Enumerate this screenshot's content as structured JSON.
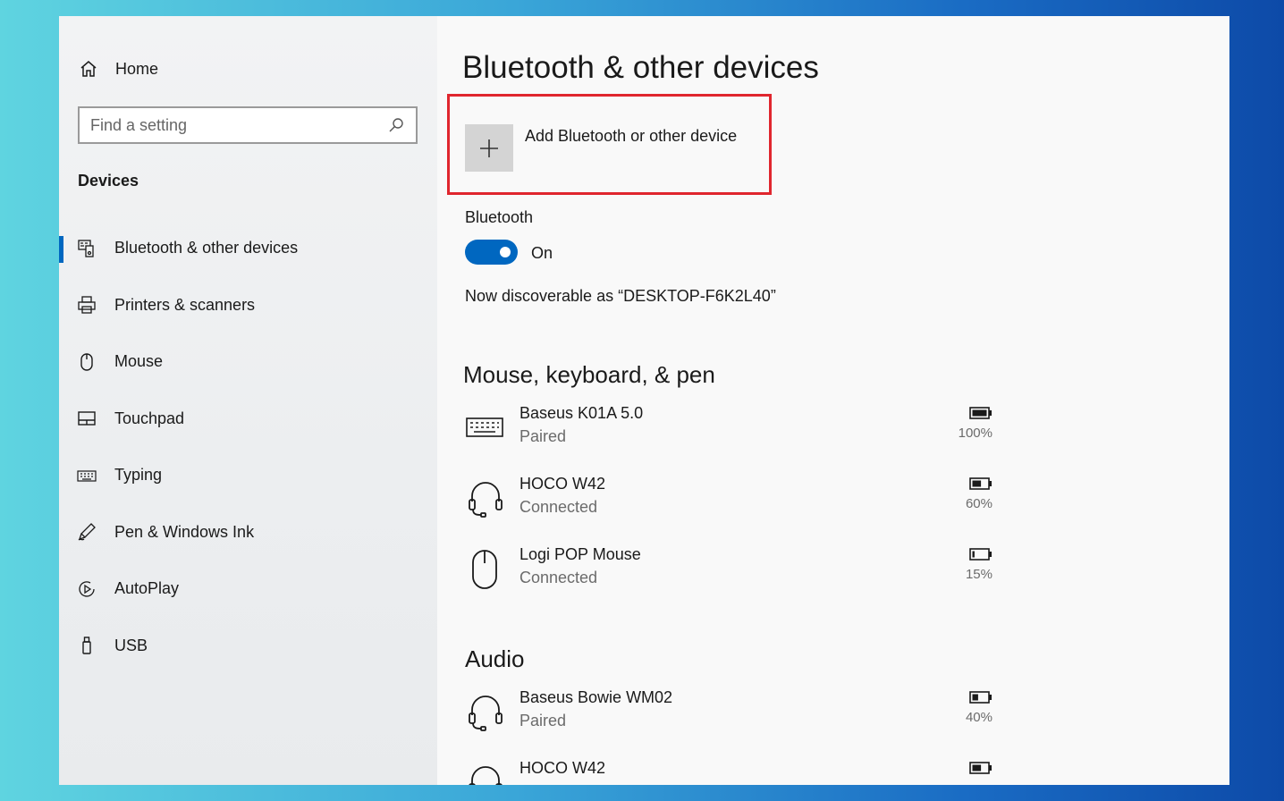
{
  "sidebar": {
    "home_label": "Home",
    "search_placeholder": "Find a setting",
    "section_label": "Devices",
    "items": [
      {
        "label": "Bluetooth & other devices",
        "icon": "bluetooth-devices-icon",
        "active": true
      },
      {
        "label": "Printers & scanners",
        "icon": "printer-icon"
      },
      {
        "label": "Mouse",
        "icon": "mouse-icon"
      },
      {
        "label": "Touchpad",
        "icon": "touchpad-icon"
      },
      {
        "label": "Typing",
        "icon": "keyboard-icon"
      },
      {
        "label": "Pen & Windows Ink",
        "icon": "pen-icon"
      },
      {
        "label": "AutoPlay",
        "icon": "autoplay-icon"
      },
      {
        "label": "USB",
        "icon": "usb-icon"
      }
    ]
  },
  "main": {
    "title": "Bluetooth & other devices",
    "add_device_label": "Add Bluetooth or other device",
    "bluetooth_label": "Bluetooth",
    "toggle_state": "On",
    "discoverable_text": "Now discoverable as “DESKTOP-F6K2L40”",
    "groups": [
      {
        "title": "Mouse, keyboard, & pen",
        "devices": [
          {
            "name": "Baseus K01A 5.0",
            "status": "Paired",
            "battery": "100%",
            "battery_level": 1.0,
            "icon": "keyboard-icon"
          },
          {
            "name": "HOCO W42",
            "status": "Connected",
            "battery": "60%",
            "battery_level": 0.6,
            "icon": "headset-icon"
          },
          {
            "name": "Logi POP Mouse",
            "status": "Connected",
            "battery": "15%",
            "battery_level": 0.15,
            "icon": "mouse-icon"
          }
        ]
      },
      {
        "title": "Audio",
        "devices": [
          {
            "name": "Baseus Bowie WM02",
            "status": "Paired",
            "battery": "40%",
            "battery_level": 0.4,
            "icon": "headset-icon"
          },
          {
            "name": "HOCO W42",
            "status": "",
            "battery": "",
            "battery_level": 0.6,
            "icon": "headset-icon"
          }
        ]
      }
    ]
  },
  "colors": {
    "accent": "#0067c0",
    "highlight_box": "#e0262e"
  }
}
